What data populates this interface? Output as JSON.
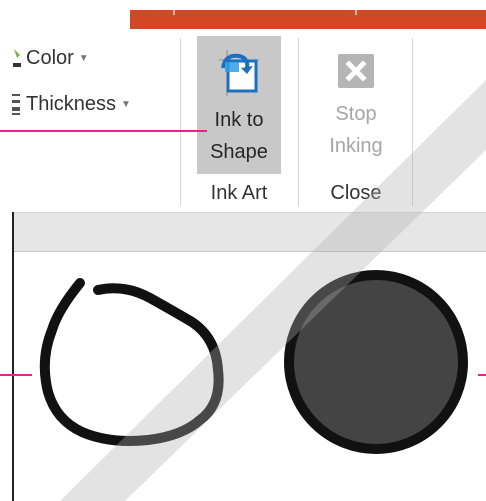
{
  "ribbon": {
    "pen_group": {
      "color_label": "Color",
      "thickness_label": "Thickness"
    },
    "ink_to_shape": {
      "label_line1": "Ink to",
      "label_line2": "Shape",
      "icon": "ink-to-shape-icon",
      "state": "selected"
    },
    "stop_inking": {
      "label_line1": "Stop",
      "label_line2": "Inking",
      "icon": "close-x-icon",
      "state": "disabled"
    },
    "groups": {
      "ink_art": "Ink Art",
      "close": "Close"
    }
  },
  "canvas": {
    "freehand_stroke": {
      "color": "#111111"
    },
    "converted_circle": {
      "fill": "#444444",
      "stroke": "#111111"
    }
  },
  "colors": {
    "accent": "#d24726",
    "callout": "#e0278b",
    "selected_button": "#c8c8c8",
    "disabled_text": "#a6a6a6"
  }
}
